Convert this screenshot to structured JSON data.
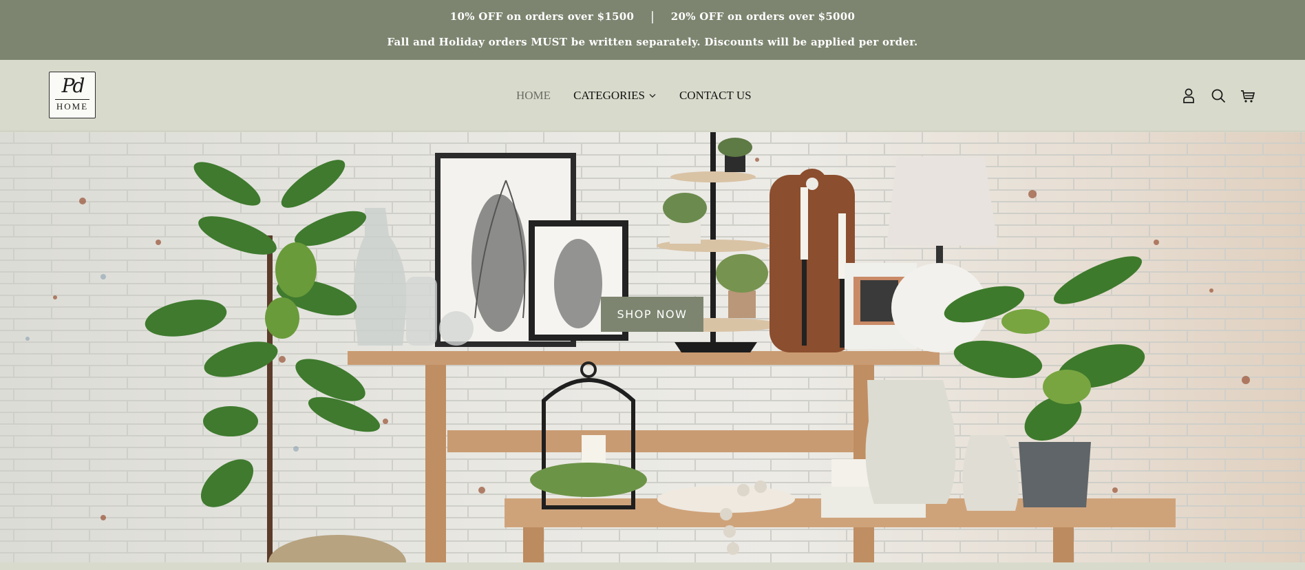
{
  "announcement": {
    "offer_1": "10% OFF on orders over $1500",
    "separator": "|",
    "offer_2": "20% OFF on orders over $5000",
    "notice": "Fall and Holiday orders MUST be written separately. Discounts will be applied per order."
  },
  "header": {
    "logo": {
      "monogram": "Pd",
      "wordmark": "HOME"
    },
    "nav": [
      {
        "label": "HOME",
        "active": true
      },
      {
        "label": "CATEGORIES",
        "has_dropdown": true,
        "dropdown_icon": "chevron-down-icon"
      },
      {
        "label": "CONTACT US"
      }
    ],
    "icons": [
      "account-icon",
      "search-icon",
      "cart-icon"
    ]
  },
  "hero": {
    "button_label": "SHOP NOW",
    "image_description": "console table styled with plants, framed fern prints, lamp, candles and pottery against a white brick wall"
  },
  "colors": {
    "announcement_bg": "#7d8570",
    "header_bg": "#d8dbcc",
    "button_bg": "#7d8570",
    "text_dark": "#111111",
    "nav_active": "#6b6b64"
  }
}
